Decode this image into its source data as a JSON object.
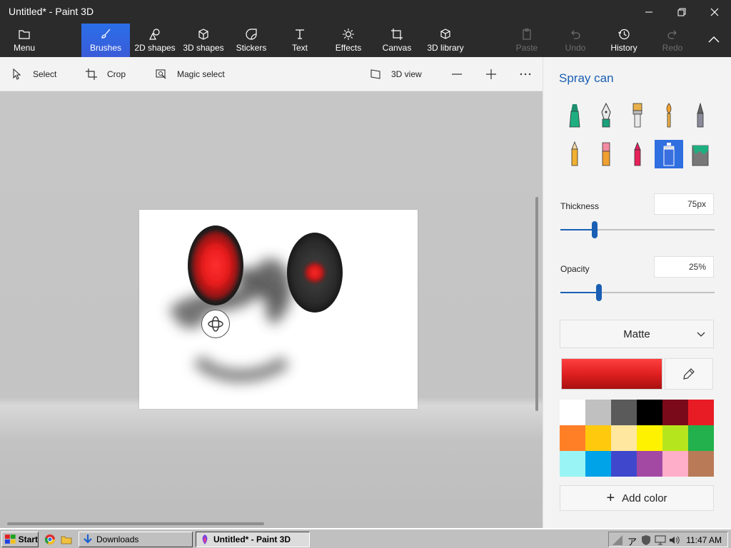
{
  "window": {
    "title": "Untitled* - Paint 3D",
    "controls": {
      "minimize": "minimize",
      "restore": "restore",
      "close": "close"
    }
  },
  "ribbon": {
    "tabs": [
      {
        "id": "menu",
        "label": "Menu",
        "icon": "folder-icon"
      },
      {
        "id": "brushes",
        "label": "Brushes",
        "icon": "brush-icon",
        "active": true
      },
      {
        "id": "2d-shapes",
        "label": "2D shapes",
        "icon": "2d-shapes-icon"
      },
      {
        "id": "3d-shapes",
        "label": "3D shapes",
        "icon": "3d-shapes-icon"
      },
      {
        "id": "stickers",
        "label": "Stickers",
        "icon": "sticker-icon"
      },
      {
        "id": "text",
        "label": "Text",
        "icon": "text-icon"
      },
      {
        "id": "effects",
        "label": "Effects",
        "icon": "sun-icon"
      },
      {
        "id": "canvas",
        "label": "Canvas",
        "icon": "canvas-icon"
      },
      {
        "id": "3d-library",
        "label": "3D library",
        "icon": "cube-icon"
      }
    ],
    "actions": [
      {
        "id": "paste",
        "label": "Paste",
        "enabled": false
      },
      {
        "id": "undo",
        "label": "Undo",
        "enabled": false
      },
      {
        "id": "history",
        "label": "History",
        "enabled": true
      },
      {
        "id": "redo",
        "label": "Redo",
        "enabled": false
      }
    ]
  },
  "toolbar": {
    "select": "Select",
    "crop": "Crop",
    "magic_select": "Magic select",
    "view_3d": "3D view"
  },
  "panel": {
    "title": "Spray can",
    "brushes": [
      "marker",
      "calligraphy-pen",
      "oil-brush",
      "watercolor",
      "pixel-pen",
      "pencil",
      "eraser",
      "crayon",
      "spray-can",
      "fill"
    ],
    "selected_brush": "spray-can",
    "thickness_label": "Thickness",
    "thickness_value": "75px",
    "thickness_fraction": 0.22,
    "opacity_label": "Opacity",
    "opacity_value": "25%",
    "opacity_fraction": 0.25,
    "finish": "Matte",
    "current_color": "#e02020",
    "palette": [
      "#ffffff",
      "#c0c0c0",
      "#5a5a5a",
      "#000000",
      "#7a0a1a",
      "#e81c24",
      "#ff7f27",
      "#ffc90e",
      "#ffe7a0",
      "#fff200",
      "#b5e61d",
      "#22b14c",
      "#99f5f5",
      "#00a2e8",
      "#3f48cc",
      "#a349a4",
      "#ffaec9",
      "#b97a57"
    ],
    "add_color": "Add color"
  },
  "taskbar": {
    "start": "Start",
    "downloads": "Downloads",
    "active_window": "Untitled* - Paint 3D",
    "tray_ime": "ア",
    "clock": "11:47 AM"
  }
}
